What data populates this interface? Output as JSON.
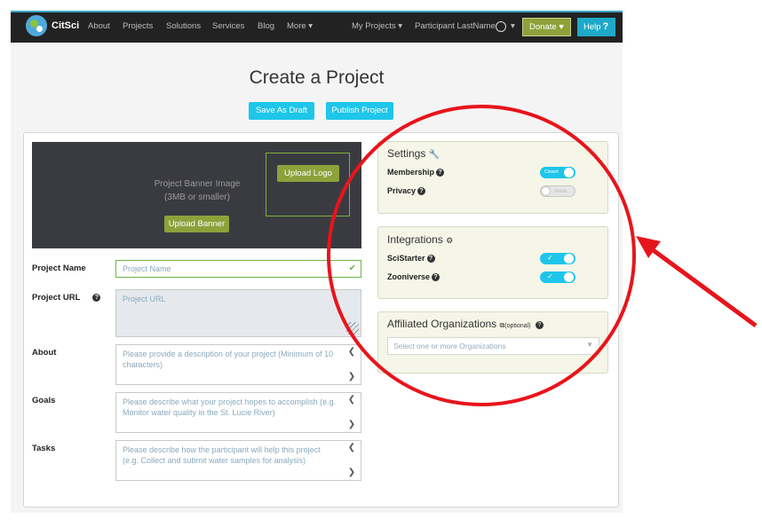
{
  "navbar": {
    "brand": "CitSci",
    "links": [
      "About",
      "Projects",
      "Solutions",
      "Services",
      "Blog",
      "More ▾"
    ],
    "my_projects": "My Projects ▾",
    "user": "Participant LastName",
    "user_caret": "▾",
    "donate": "Donate ♥",
    "help": "Help",
    "help_icon": "?"
  },
  "page": {
    "title": "Create a Project",
    "save_draft": "Save As Draft",
    "publish": "Publish Project"
  },
  "banner": {
    "text_line1": "Project Banner Image",
    "text_line2": "(3MB or smaller)",
    "upload_banner": "Upload Banner",
    "upload_logo": "Upload Logo"
  },
  "form": {
    "name_label": "Project Name",
    "name_placeholder": "Project Name",
    "url_label": "Project URL",
    "url_placeholder": "Project URL",
    "about_label": "About",
    "about_placeholder": "Please provide a description of your project (Minimum of 10 characters)",
    "goals_label": "Goals",
    "goals_placeholder": "Please describe what your project hopes to accomplish (e.g. Monitor water quality in the St. Lucie River)",
    "tasks_label": "Tasks",
    "tasks_placeholder": "Please describe how the participant will help this project (e.g. Collect and submit water samples for analysis)"
  },
  "settings": {
    "title": "Settings",
    "title_icon": "wrench-icon",
    "membership_label": "Membership",
    "membership_state": "Closed",
    "privacy_label": "Privacy",
    "privacy_state": "Visible"
  },
  "integrations": {
    "title": "Integrations",
    "title_icon": "cogs-icon",
    "scistarter_label": "SciStarter",
    "zooniverse_label": "Zooniverse",
    "on_mark": "✓"
  },
  "affiliated": {
    "title": "Affiliated Organizations",
    "optional": "(optional)",
    "title_icon": "sitemap-icon",
    "placeholder": "Select one or more Organizations"
  },
  "colors": {
    "navbar": "#222222",
    "cyan": "#1dc6ea",
    "olive": "#8ea13b",
    "annotation": "#e8141b"
  }
}
